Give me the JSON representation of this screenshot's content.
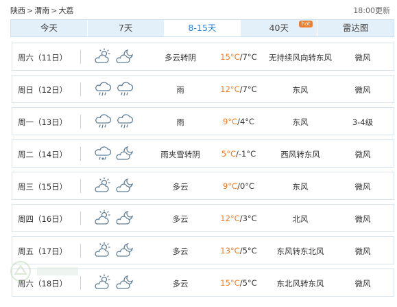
{
  "breadcrumb": [
    "陕西",
    "渭南",
    "大荔"
  ],
  "breadcrumb_sep": ">",
  "updated": "18:00更新",
  "tabs": [
    {
      "label": "今天"
    },
    {
      "label": "7天"
    },
    {
      "label": "8-15天"
    },
    {
      "label": "40天",
      "badge": "hot"
    },
    {
      "label": "雷达图"
    }
  ],
  "active_tab": "8-15天",
  "colors": {
    "accent": "#2a86d6",
    "temp_high": "#f07c1f",
    "tab_bg": "#e3eff9",
    "hot_badge": "#f07d29"
  },
  "days": [
    {
      "day": "周六（11日）",
      "icons": [
        "partly-cloudy-day-icon",
        "cloud-moon-icon"
      ],
      "condition": "多云转阴",
      "high": "15°C",
      "low": "7°C",
      "wind": "无持续风向转东风",
      "level": "微风"
    },
    {
      "day": "周日（12日）",
      "icons": [
        "rain-icon",
        "rain-icon"
      ],
      "condition": "雨",
      "high": "12°C",
      "low": "7°C",
      "wind": "东风",
      "level": "微风"
    },
    {
      "day": "周一（13日）",
      "icons": [
        "rain-icon",
        "rain-icon"
      ],
      "condition": "雨",
      "high": "9°C",
      "low": "4°C",
      "wind": "东风",
      "level": "3-4级"
    },
    {
      "day": "周二（14日）",
      "icons": [
        "sleet-icon",
        "cloud-moon-icon"
      ],
      "condition": "雨夹雪转阴",
      "high": "5°C",
      "low": "-1°C",
      "wind": "西风转东风",
      "level": "微风"
    },
    {
      "day": "周三（15日）",
      "icons": [
        "partly-cloudy-day-icon",
        "cloud-moon-icon"
      ],
      "condition": "多云",
      "high": "9°C",
      "low": "0°C",
      "wind": "东风",
      "level": "微风"
    },
    {
      "day": "周四（16日）",
      "icons": [
        "partly-cloudy-day-icon",
        "cloud-moon-icon"
      ],
      "condition": "多云",
      "high": "12°C",
      "low": "3°C",
      "wind": "北风",
      "level": "微风"
    },
    {
      "day": "周五（17日）",
      "icons": [
        "partly-cloudy-day-icon",
        "cloud-moon-icon"
      ],
      "condition": "多云",
      "high": "13°C",
      "low": "5°C",
      "wind": "东风转东北风",
      "level": "微风"
    },
    {
      "day": "周六（18日）",
      "icons": [
        "partly-cloudy-day-icon",
        "cloud-moon-icon"
      ],
      "condition": "多云",
      "high": "15°C",
      "low": "5°C",
      "wind": "东北风转东风",
      "level": "微风"
    }
  ]
}
